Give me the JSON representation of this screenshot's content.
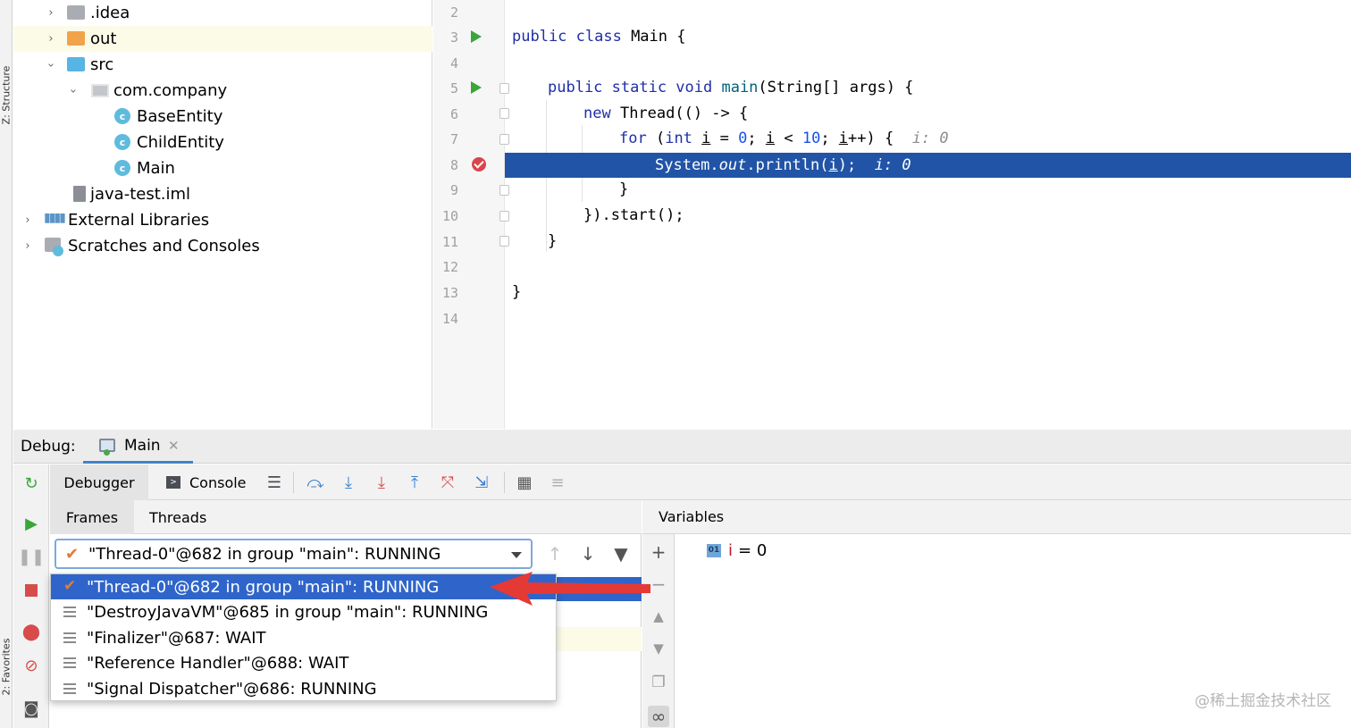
{
  "sidebar": {
    "structure_label": "Z: Structure",
    "favorites_label": "2: Favorites"
  },
  "project_tree": [
    {
      "label": ".idea",
      "icon": "folder-icon",
      "expanded": false
    },
    {
      "label": "out",
      "icon": "folder-orange-icon",
      "expanded": false
    },
    {
      "label": "src",
      "icon": "folder-source-icon",
      "expanded": true
    },
    {
      "label": "com.company",
      "icon": "package-icon",
      "expanded": true
    },
    {
      "label": "BaseEntity",
      "icon": "class-icon"
    },
    {
      "label": "ChildEntity",
      "icon": "class-icon"
    },
    {
      "label": "Main",
      "icon": "class-runnable-icon"
    },
    {
      "label": "java-test.iml",
      "icon": "iml-file-icon"
    },
    {
      "label": "External Libraries",
      "icon": "libraries-icon",
      "expanded": false
    },
    {
      "label": "Scratches and Consoles",
      "icon": "scratches-icon",
      "expanded": false
    }
  ],
  "editor": {
    "line_numbers": [
      "2",
      "3",
      "4",
      "5",
      "6",
      "7",
      "8",
      "9",
      "10",
      "11",
      "12",
      "13",
      "14"
    ],
    "code": {
      "l3_kw": "public class ",
      "l3_rest": "Main {",
      "l5_kw": "public static void ",
      "l5_fn": "main",
      "l5_rest": "(String[] args) {",
      "l6_kw": "new ",
      "l6_rest": "Thread(() -> {",
      "l7_kw": "for ",
      "l7_a": "(",
      "l7_int": "int ",
      "l7_i1": "i",
      "l7_b": " = ",
      "l7_zero": "0",
      "l7_c": "; ",
      "l7_i2": "i",
      "l7_d": " < ",
      "l7_ten": "10",
      "l7_e": "; ",
      "l7_i3": "i",
      "l7_f": "++) {",
      "l7_hint": "i: 0",
      "l8_a": "System.",
      "l8_out": "out",
      "l8_b": ".println(",
      "l8_i": "i",
      "l8_c": ");",
      "l8_hint": "i: 0",
      "l9": "}",
      "l10": "}).start();",
      "l11": "}",
      "l13": "}"
    }
  },
  "debug": {
    "label": "Debug:",
    "tab": "Main",
    "toolbar": {
      "debugger": "Debugger",
      "console": "Console"
    },
    "frames_tabs": {
      "frames": "Frames",
      "threads": "Threads"
    },
    "selected_thread": "\"Thread-0\"@682 in group \"main\": RUNNING",
    "threads": [
      "\"Thread-0\"@682 in group \"main\": RUNNING",
      "\"DestroyJavaVM\"@685 in group \"main\": RUNNING",
      "\"Finalizer\"@687: WAIT",
      "\"Reference Handler\"@688: WAIT",
      "\"Signal Dispatcher\"@686: RUNNING"
    ],
    "variables": {
      "header": "Variables",
      "type_badge": "01",
      "name": "i",
      "eq": "= 0"
    }
  },
  "watermark": "@稀土掘金技术社区",
  "colors": {
    "accent_blue": "#2154a6",
    "selection_blue": "#2f65ca",
    "arrow_red": "#e53935"
  }
}
